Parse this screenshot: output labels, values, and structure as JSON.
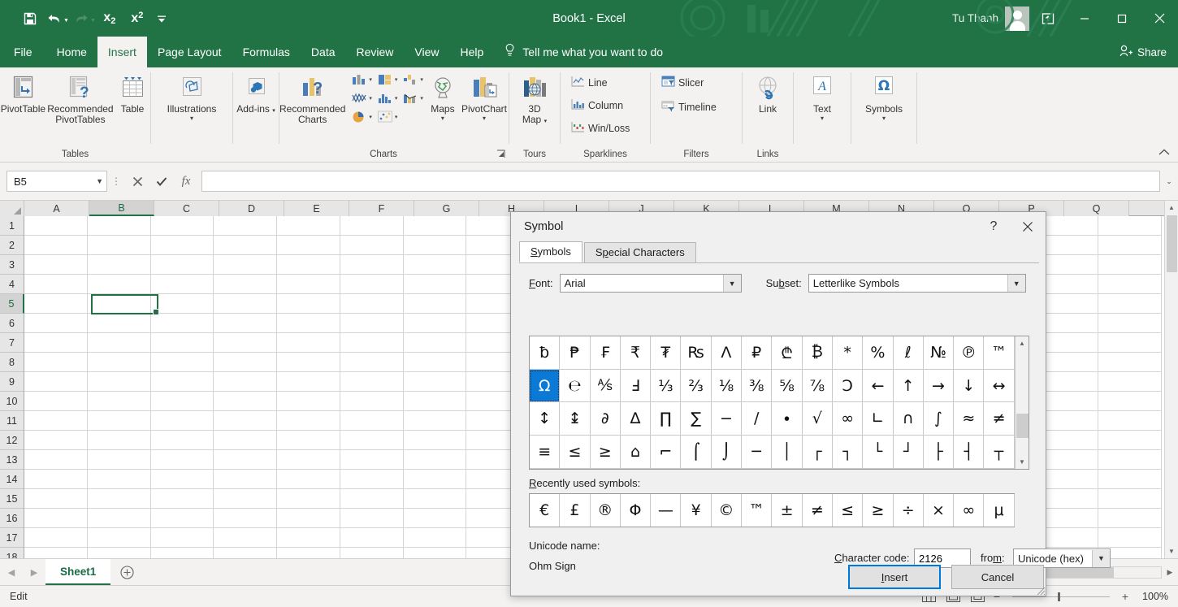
{
  "titlebar": {
    "document_title": "Book1  -  Excel",
    "account_name": "Tu Thanh",
    "qat": [
      {
        "name": "save",
        "glyph": "💾"
      },
      {
        "name": "undo",
        "glyph": "↶"
      },
      {
        "name": "redo",
        "glyph": "↷"
      },
      {
        "name": "subscript",
        "glyph": "x₂"
      },
      {
        "name": "superscript",
        "glyph": "x²"
      },
      {
        "name": "customize-qat",
        "glyph": "▾"
      }
    ],
    "ribbon_display_options": "⬆",
    "minimize": "—",
    "restore": "□",
    "close": "✕"
  },
  "ribbon_tabs": [
    {
      "label": "File",
      "active": false
    },
    {
      "label": "Home",
      "active": false
    },
    {
      "label": "Insert",
      "active": true
    },
    {
      "label": "Page Layout",
      "active": false
    },
    {
      "label": "Formulas",
      "active": false
    },
    {
      "label": "Data",
      "active": false
    },
    {
      "label": "Review",
      "active": false
    },
    {
      "label": "View",
      "active": false
    },
    {
      "label": "Help",
      "active": false
    }
  ],
  "tellme": {
    "placeholder": "Tell me what you want to do"
  },
  "share": {
    "label": "Share"
  },
  "ribbon": {
    "groups": [
      {
        "name": "Tables",
        "items": [
          {
            "label": "PivotTable",
            "icon": "pivot-table-icon"
          },
          {
            "label": "Recommended PivotTables",
            "icon": "recommended-pivottables-icon"
          },
          {
            "label": "Table",
            "icon": "table-icon"
          }
        ]
      },
      {
        "name": "",
        "items": [
          {
            "label": "Illustrations",
            "icon": "illustrations-icon",
            "caret": true
          }
        ]
      },
      {
        "name": "",
        "items": [
          {
            "label": "Add-ins",
            "icon": "addins-icon",
            "caret": true
          }
        ]
      },
      {
        "name": "Charts",
        "items": [
          {
            "label": "Recommended Charts",
            "icon": "recommended-charts-icon"
          },
          {
            "label": "Maps",
            "icon": "maps-icon",
            "caret": true
          },
          {
            "label": "PivotChart",
            "icon": "pivotchart-icon",
            "caret": true
          }
        ],
        "chart_icons": [
          "column-chart-icon",
          "hierarchy-chart-icon",
          "waterfall-chart-icon",
          "line-chart-icon",
          "statistic-chart-icon",
          "combo-chart-icon",
          "pie-chart-icon",
          "scatter-chart-icon"
        ]
      },
      {
        "name": "Tours",
        "items": [
          {
            "label": "3D Map",
            "icon": "3d-map-icon",
            "caret": true
          }
        ]
      },
      {
        "name": "Sparklines",
        "small_items": [
          {
            "label": "Line",
            "icon": "sparkline-line-icon"
          },
          {
            "label": "Column",
            "icon": "sparkline-column-icon"
          },
          {
            "label": "Win/Loss",
            "icon": "sparkline-winloss-icon"
          }
        ]
      },
      {
        "name": "Filters",
        "small_items": [
          {
            "label": "Slicer",
            "icon": "slicer-icon"
          },
          {
            "label": "Timeline",
            "icon": "timeline-icon"
          }
        ]
      },
      {
        "name": "Links",
        "items": [
          {
            "label": "Link",
            "icon": "link-icon"
          }
        ]
      },
      {
        "name": "",
        "items": [
          {
            "label": "Text",
            "icon": "text-icon",
            "caret": true
          }
        ]
      },
      {
        "name": "",
        "items": [
          {
            "label": "Symbols",
            "icon": "symbols-omega-icon",
            "caret": true
          }
        ]
      }
    ]
  },
  "formula_bar": {
    "name_box_value": "B5",
    "cancel_icon": "✕",
    "enter_icon": "✓",
    "function_icon": "fx",
    "formula_value": "",
    "expand_icon": "⌄"
  },
  "sheet": {
    "columns": [
      "A",
      "B",
      "C",
      "D",
      "E",
      "F",
      "G",
      "H",
      "I",
      "J",
      "K",
      "L",
      "M",
      "N",
      "O",
      "P",
      "Q"
    ],
    "rows": [
      "1",
      "2",
      "3",
      "4",
      "5",
      "6",
      "7",
      "8",
      "9",
      "10",
      "11",
      "12",
      "13",
      "14",
      "15",
      "16",
      "17",
      "18"
    ],
    "selected_cell": "B5",
    "selected_column": "B",
    "selected_row": "5"
  },
  "sheet_tabs": {
    "prev_icon": "◀",
    "next_icon": "▶",
    "tabs": [
      {
        "label": "Sheet1",
        "active": true
      }
    ],
    "add_label": "+"
  },
  "status_bar": {
    "mode": "Edit",
    "views": [
      "normal-view-icon",
      "page-layout-view-icon",
      "page-break-preview-icon"
    ],
    "zoom_out": "−",
    "zoom_in": "+",
    "zoom_level": "100%"
  },
  "dialog": {
    "title": "Symbol",
    "help_icon": "?",
    "close_icon": "✕",
    "tabs": [
      {
        "label": "Symbols",
        "accel": "S",
        "active": true
      },
      {
        "label": "Special Characters",
        "accel": "p",
        "active": false
      }
    ],
    "font_label": "Font:",
    "font_accel": "F",
    "font_value": "Arial",
    "subset_label": "Subset:",
    "subset_accel": "b",
    "subset_value": "Letterlike Symbols",
    "grid_rows": [
      [
        "ƀ",
        "₱",
        "₣",
        "₹",
        "₮",
        "₨",
        "Ʌ",
        "₽",
        "₾",
        "₿",
        "*",
        "%",
        "ℓ",
        "№",
        "℗",
        "™"
      ],
      [
        "Ω",
        "℮",
        "⅍",
        "Ⅎ",
        "⅓",
        "⅔",
        "⅛",
        "⅜",
        "⅝",
        "⅞",
        "Ↄ",
        "←",
        "↑",
        "→",
        "↓",
        "↔"
      ],
      [
        "↕",
        "↨",
        "∂",
        "∆",
        "∏",
        "∑",
        "−",
        "∕",
        "∙",
        "√",
        "∞",
        "∟",
        "∩",
        "∫",
        "≈",
        "≠"
      ],
      [
        "≡",
        "≤",
        "≥",
        "⌂",
        "⌐",
        "⌠",
        "⌡",
        "─",
        "│",
        "┌",
        "┐",
        "└",
        "┘",
        "├",
        "┤",
        "┬"
      ]
    ],
    "selected_symbol": "Ω",
    "selected_row_index": 1,
    "selected_col_index": 0,
    "recent_label": "Recently used symbols:",
    "recent_accel": "R",
    "recent_symbols": [
      "€",
      "£",
      "®",
      "Φ",
      "—",
      "¥",
      "©",
      "™",
      "±",
      "≠",
      "≤",
      "≥",
      "÷",
      "×",
      "∞",
      "μ"
    ],
    "unicode_name_label": "Unicode name:",
    "unicode_name_value": "Ohm Sign",
    "char_code_label": "Character code:",
    "char_code_accel": "C",
    "char_code_value": "2126",
    "from_label": "from:",
    "from_accel": "m",
    "from_value": "Unicode (hex)",
    "insert_button": "Insert",
    "insert_accel": "I",
    "cancel_button": "Cancel"
  },
  "colors": {
    "excel_green": "#217346",
    "accent_blue": "#0078d7",
    "selection_blue": "#0a7ad6"
  }
}
